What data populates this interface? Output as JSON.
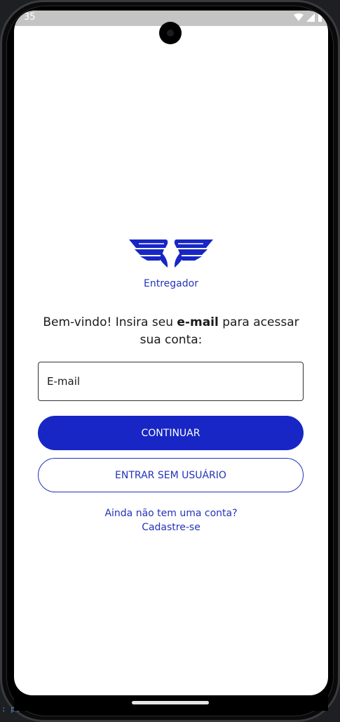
{
  "status_bar": {
    "time": "35",
    "icons": [
      "wifi-icon",
      "signal-icon",
      "battery-icon"
    ]
  },
  "logo": {
    "icon": "winged-logo-icon",
    "color": "#1726c4"
  },
  "brand": {
    "name": "Entregador"
  },
  "welcome": {
    "prefix": "Bem-vindo! Insira seu ",
    "bold": "e-mail",
    "suffix": " para acessar sua conta:"
  },
  "email_input": {
    "placeholder": "E-mail",
    "value": ""
  },
  "buttons": {
    "continue_label": "CONTINUAR",
    "guest_label": "ENTRAR SEM USUÁRIO"
  },
  "signup": {
    "line1": "Ainda não tem uma conta?",
    "line2": "Cadastre-se"
  },
  "background_hint": {
    "text": ": pt"
  },
  "colors": {
    "accent": "#1726c4",
    "link": "#2433b8",
    "screen_bg": "#ffffff",
    "status_bar_bg": "#c4c4c4"
  }
}
